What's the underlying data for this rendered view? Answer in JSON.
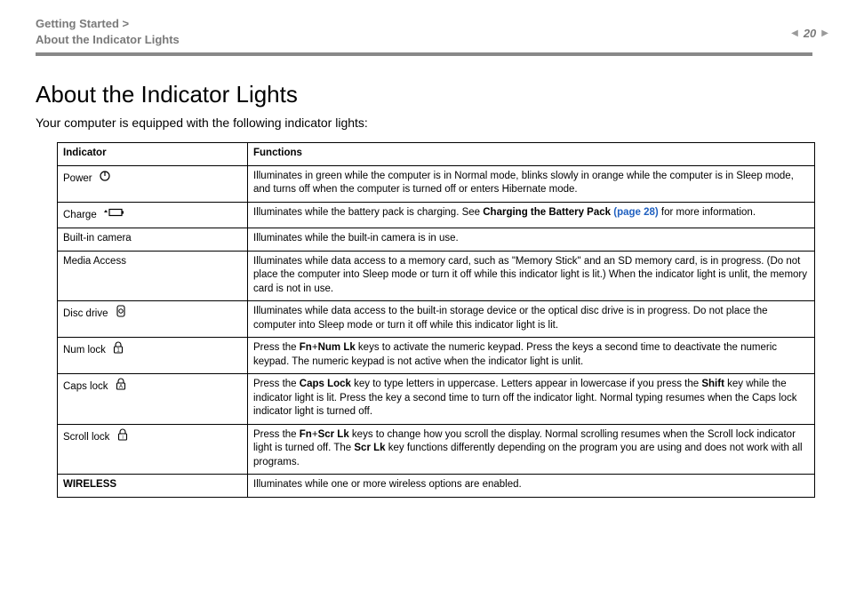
{
  "breadcrumb": {
    "line1": "Getting Started >",
    "line2": "About the Indicator Lights"
  },
  "page_number": "20",
  "heading": "About the Indicator Lights",
  "intro": "Your computer is equipped with the following indicator lights:",
  "table": {
    "headers": {
      "c1": "Indicator",
      "c2": "Functions"
    },
    "rows": [
      {
        "indicator": "Power",
        "icon": "power-icon",
        "indicator_bold": false,
        "segments": [
          {
            "t": "Illuminates in green while the computer is in Normal mode, blinks slowly in orange while the computer is in Sleep mode, and turns off when the computer is turned off or enters Hibernate mode."
          }
        ]
      },
      {
        "indicator": "Charge",
        "icon": "charge-icon",
        "indicator_bold": false,
        "segments": [
          {
            "t": "Illuminates while the battery pack is charging. See "
          },
          {
            "t": "Charging the Battery Pack ",
            "b": true
          },
          {
            "t": "(page 28)",
            "link": true
          },
          {
            "t": " for more information."
          }
        ]
      },
      {
        "indicator": "Built-in camera",
        "icon": null,
        "indicator_bold": false,
        "segments": [
          {
            "t": "Illuminates while the built-in camera is in use."
          }
        ]
      },
      {
        "indicator": "Media Access",
        "icon": null,
        "indicator_bold": false,
        "segments": [
          {
            "t": "Illuminates while data access to a memory card, such as \"Memory Stick\" and an SD memory card, is in progress. (Do not place the computer into Sleep mode or turn it off while this indicator light is lit.) When the indicator light is unlit, the memory card is not in use."
          }
        ]
      },
      {
        "indicator": "Disc drive",
        "icon": "disc-icon",
        "indicator_bold": false,
        "segments": [
          {
            "t": "Illuminates while data access to the built-in storage device or the optical disc drive is in progress. Do not place the computer into Sleep mode or turn it off while this indicator light is lit."
          }
        ]
      },
      {
        "indicator": "Num lock",
        "icon": "numlock-icon",
        "indicator_bold": false,
        "segments": [
          {
            "t": "Press the "
          },
          {
            "t": "Fn",
            "b": true
          },
          {
            "t": "+"
          },
          {
            "t": "Num Lk",
            "b": true
          },
          {
            "t": " keys to activate the numeric keypad. Press the keys a second time to deactivate the numeric keypad. The numeric keypad is not active when the indicator light is unlit."
          }
        ]
      },
      {
        "indicator": "Caps lock",
        "icon": "capslock-icon",
        "indicator_bold": false,
        "segments": [
          {
            "t": "Press the "
          },
          {
            "t": "Caps Lock",
            "b": true
          },
          {
            "t": " key to type letters in uppercase. Letters appear in lowercase if you press the "
          },
          {
            "t": "Shift",
            "b": true
          },
          {
            "t": " key while the indicator light is lit. Press the key a second time to turn off the indicator light. Normal typing resumes when the Caps lock indicator light is turned off."
          }
        ]
      },
      {
        "indicator": "Scroll lock",
        "icon": "scrolllock-icon",
        "indicator_bold": false,
        "segments": [
          {
            "t": "Press the "
          },
          {
            "t": "Fn",
            "b": true
          },
          {
            "t": "+"
          },
          {
            "t": "Scr Lk",
            "b": true
          },
          {
            "t": " keys to change how you scroll the display. Normal scrolling resumes when the Scroll lock indicator light is turned off. The "
          },
          {
            "t": "Scr Lk",
            "b": true
          },
          {
            "t": " key functions differently depending on the program you are using and does not work with all programs."
          }
        ]
      },
      {
        "indicator": "WIRELESS",
        "icon": null,
        "indicator_bold": true,
        "segments": [
          {
            "t": "Illuminates while one or more wireless options are enabled."
          }
        ]
      }
    ]
  }
}
